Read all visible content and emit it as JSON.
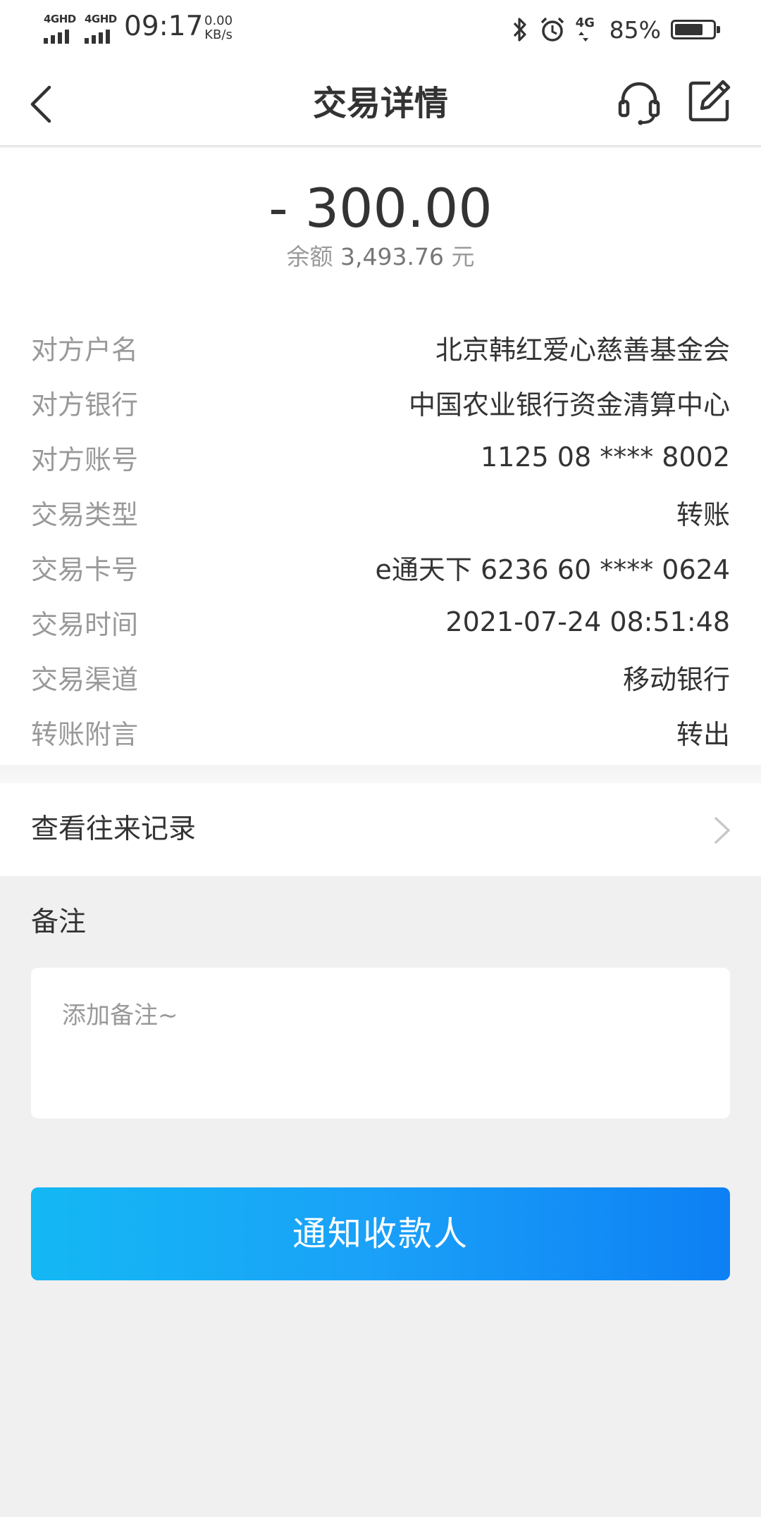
{
  "status_bar": {
    "network_1": "4GHD",
    "network_2": "4GHD",
    "time": "09:17",
    "speed_value": "0.00",
    "speed_unit": "KB/s",
    "net_type": "4G",
    "battery_percent": "85%",
    "battery_level": 0.85,
    "icons": [
      "bluetooth-icon",
      "alarm-icon",
      "4g-icon",
      "battery-icon"
    ]
  },
  "nav": {
    "title": "交易详情",
    "back_icon": "chevron-left-icon",
    "service_icon": "headset-icon",
    "edit_icon": "edit-icon"
  },
  "transaction": {
    "amount": "- 300.00",
    "balance_label": "余额",
    "balance_value": "3,493.76",
    "balance_unit": "元",
    "rows": [
      {
        "label": "对方户名",
        "value": "北京韩红爱心慈善基金会"
      },
      {
        "label": "对方银行",
        "value": "中国农业银行资金清算中心"
      },
      {
        "label": "对方账号",
        "value": "1125 08 **** 8002"
      },
      {
        "label": "交易类型",
        "value": "转账"
      },
      {
        "label": "交易卡号",
        "value": "e通天下 6236 60 **** 0624"
      },
      {
        "label": "交易时间",
        "value": "2021-07-24 08:51:48"
      },
      {
        "label": "交易渠道",
        "value": "移动银行"
      },
      {
        "label": "转账附言",
        "value": "转出"
      }
    ]
  },
  "history": {
    "label": "查看往来记录",
    "icon": "chevron-right-icon"
  },
  "remark": {
    "title": "备注",
    "placeholder": "添加备注~"
  },
  "action": {
    "notify_label": "通知收款人"
  },
  "colors": {
    "button_start": "#14b8f4",
    "button_end": "#0d80f4",
    "label_gray": "#999999",
    "text_dark": "#333333",
    "page_bg": "#f0f0f0"
  }
}
